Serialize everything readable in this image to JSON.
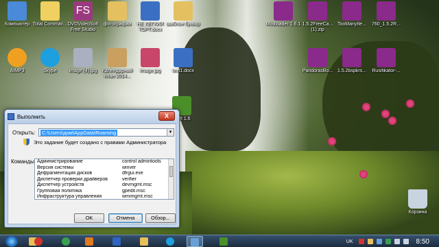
{
  "desktop": {
    "icons": [
      {
        "label": "Компьютер",
        "color": "#4a8ad8"
      },
      {
        "label": "Total Comman...",
        "color": "#f0d060"
      },
      {
        "label": "DVDVideoSoft Free Studio",
        "color": "#9a3a7e"
      },
      {
        "label": "фотографии",
        "color": "#e4c060"
      },
      {
        "label": "НЕ ЛЕГКИЙ ТОРТ.docx",
        "color": "#3b6fc4"
      },
      {
        "label": "шаблон буквар",
        "color": "#e4c060"
      },
      {
        "label": "AIMP3",
        "color": "#f0a020"
      },
      {
        "label": "Skype",
        "color": "#1e9fe0"
      },
      {
        "label": "image (4).jpg",
        "color": "#aab0c0"
      },
      {
        "label": "Календарный план 2014...",
        "color": "#c9a060"
      },
      {
        "label": "image.jpg",
        "color": "#c8466a"
      },
      {
        "label": "text1.docx",
        "color": "#3b6fc4"
      },
      {
        "label": "Modloader 1.6.1",
        "color": "#8a2a8a"
      },
      {
        "label": "1.5.2FreeCa... (1).zip",
        "color": "#8a2a8a"
      },
      {
        "label": "TooManyIte...",
        "color": "#8a2a8a"
      },
      {
        "label": "760_1.5.2R...",
        "color": "#8a2a8a"
      },
      {
        "label": "PandorasBo...",
        "color": "#8a2a8a"
      },
      {
        "label": "1.5.2bspkrs...",
        "color": "#8a2a8a"
      },
      {
        "label": "Rusifikator-...",
        "color": "#8a2a8a"
      },
      {
        "label": "craft 1.6",
        "color": "#4b8f2a"
      },
      {
        "label": "Корзина",
        "color": "#c8d4e0"
      }
    ]
  },
  "run_dialog": {
    "title": "Выполнить",
    "close_label": "X",
    "open_label": "Открыть:",
    "open_value": "C:\\Users\\дом\\AppData\\Roaming",
    "dropdown_arrow": "▼",
    "admin_note": "Это задание будет создано с правами Администратора",
    "commands_label": "Команды:",
    "commands": [
      {
        "name": "Администрирование",
        "cmd": "control admintools"
      },
      {
        "name": "Версия системы",
        "cmd": "winver"
      },
      {
        "name": "Дефрагментация дисков",
        "cmd": "dfrgui.exe"
      },
      {
        "name": "Диспетчер проверки драйверов",
        "cmd": "verifier"
      },
      {
        "name": "Диспетчер устройств",
        "cmd": "devmgmt.msc"
      },
      {
        "name": "Групповая политика",
        "cmd": "gpedit.msc"
      },
      {
        "name": "Инфраструктура управления",
        "cmd": "wmimgmt.msc"
      }
    ],
    "ok_label": "OK",
    "cancel_label": "Отмена",
    "browse_label": "Обзор..."
  },
  "taskbar": {
    "apps": [
      {
        "name": "explorer",
        "color": "#e8c05a"
      },
      {
        "name": "opera",
        "color": "#d0342c"
      },
      {
        "name": "chrome",
        "color": "#3aa050"
      },
      {
        "name": "media",
        "color": "#e07a20"
      },
      {
        "name": "word",
        "color": "#2f65c0"
      },
      {
        "name": "folder",
        "color": "#e8c05a"
      },
      {
        "name": "skype",
        "color": "#1e9fe0"
      },
      {
        "name": "run",
        "color": "#6aa0d8"
      },
      {
        "name": "minecraft",
        "color": "#4b8f2a"
      }
    ],
    "language": "UK",
    "clock": "8:50"
  },
  "colors": {
    "dialog_bg": "#c5d6ea",
    "selection": "#3399ff",
    "taskbar": "#1c2c3f"
  }
}
